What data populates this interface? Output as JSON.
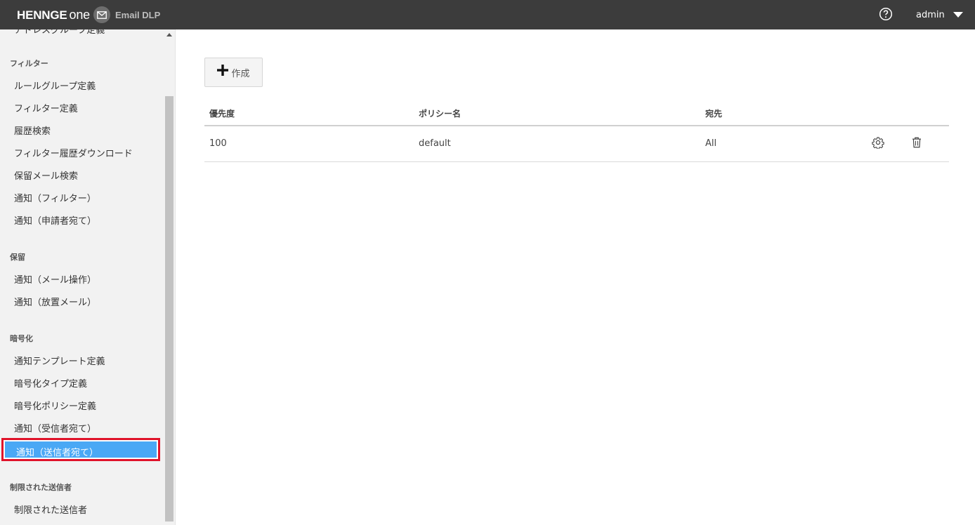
{
  "header": {
    "brand": "HENNGE",
    "brand_suffix": "one",
    "product": "Email DLP",
    "user": "admin",
    "icons": {
      "brand": "mail-icon",
      "help": "help-circle-icon",
      "user_menu": "caret-down-icon"
    }
  },
  "sidebar": {
    "cut_item": "アドレスグループ定義",
    "sections": [
      {
        "title": "フィルター",
        "items": [
          "ルールグループ定義",
          "フィルター定義",
          "履歴検索",
          "フィルター履歴ダウンロード",
          "保留メール検索",
          "通知（フィルター）",
          "通知（申請者宛て）"
        ]
      },
      {
        "title": "保留",
        "items": [
          "通知（メール操作）",
          "通知（放置メール）"
        ]
      },
      {
        "title": "暗号化",
        "items": [
          "通知テンプレート定義",
          "暗号化タイプ定義",
          "暗号化ポリシー定義",
          "通知（受信者宛て）",
          "通知（送信者宛て）"
        ]
      },
      {
        "title": "制限された送信者",
        "items": [
          "制限された送信者"
        ]
      }
    ],
    "active_item": "通知（送信者宛て）"
  },
  "main": {
    "create_label": "作成",
    "table": {
      "headers": [
        "優先度",
        "ポリシー名",
        "宛先"
      ],
      "rows": [
        {
          "priority": "100",
          "name": "default",
          "recipient": "All"
        }
      ],
      "row_actions": [
        "gear-icon",
        "trash-icon"
      ]
    }
  }
}
